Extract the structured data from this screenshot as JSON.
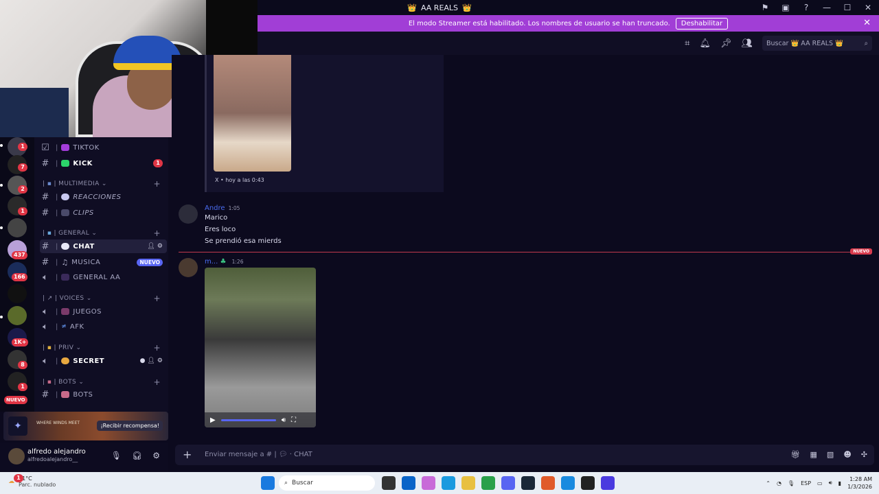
{
  "window": {
    "title": "AA REALS",
    "title_crowns": "👑",
    "controls": {
      "flag": "⚑",
      "screen": "▣",
      "help": "?",
      "min": "—",
      "max": "☐",
      "close": "✕"
    }
  },
  "banner": {
    "text": "El modo Streamer está habilitado. Los nombres de usuario se han truncado.",
    "button": "Deshabilitar",
    "close": "✕"
  },
  "header": {
    "search_placeholder": "Buscar 👑 AA REALS 👑",
    "search_icon": "⌕"
  },
  "servers": {
    "badges": [
      "1",
      "7",
      "2",
      "1",
      "437",
      "166",
      "1K+",
      "8",
      "1"
    ],
    "nuevo": "NUEVO",
    "nuevo_count": "122"
  },
  "channels": {
    "tiktok": "TIKTOK",
    "kick": "KICK",
    "kick_badge": "1",
    "cat_multimedia": "MULTIMEDIA",
    "reacciones": "REACCIONES",
    "clips": "CLIPS",
    "cat_general": "GENERAL",
    "chat": "CHAT",
    "musica": "MUSICA",
    "musica_pill": "NUEVO",
    "general_aa": "GENERAL AA",
    "cat_voices": "VOICES",
    "juegos": "JUEGOS",
    "afk": "AFK",
    "cat_priv": "PRIV",
    "secret": "SECRET",
    "cat_bots": "BOTS",
    "bots": "BOTS"
  },
  "promo": {
    "game": "WHERE WINDS MEET",
    "button": "¡Recibir recompensa!"
  },
  "user": {
    "name": "alfredo alejandro",
    "handle": "alfredoalejandro__"
  },
  "messages": {
    "embed_source": "X • hoy a las 0:43",
    "m1_author": "Andre",
    "m1_time": "1:05",
    "m1_lines": [
      "Marico",
      "Eres loco",
      "Se prendió esa mierds"
    ],
    "nuevo": "NUEVO",
    "m2_author": "m...",
    "m2_time": "1:26"
  },
  "composer": {
    "placeholder": "Enviar mensaje a # |",
    "channel": "CHAT"
  },
  "taskbar": {
    "temp": "21°C",
    "weather": "Parc. nublado",
    "weather_badge": "1",
    "search": "Buscar",
    "lang": "ESP",
    "time": "1:28 AM",
    "date": "1/3/2026"
  }
}
